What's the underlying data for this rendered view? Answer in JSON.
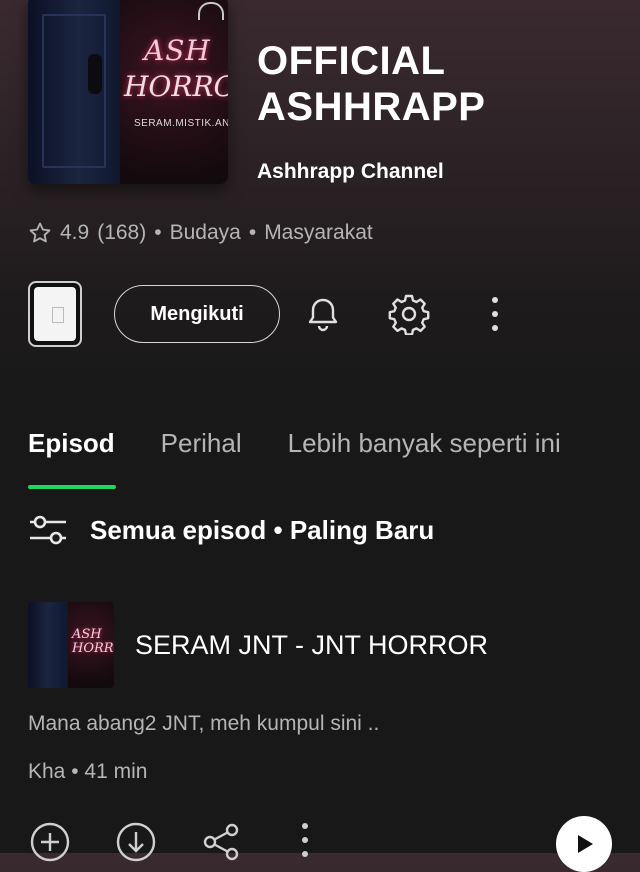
{
  "podcast": {
    "title_line1": "OFFICIAL",
    "title_line2": "ASHHRAPP",
    "channel": "Ashhrapp Channel",
    "cover": {
      "title1": "ASH",
      "title2": "HORROR",
      "subtitle": "SERAM.MISTIK.ANGKER"
    }
  },
  "rating": {
    "icon": "star-outline-icon",
    "score": "4.9",
    "count": "(168)",
    "separator": "•",
    "categories": [
      "Budaya",
      "Masyarakat"
    ]
  },
  "actions": {
    "follow_label": "Mengikuti",
    "icons": [
      "bell-icon",
      "gear-icon",
      "more-vertical-icon"
    ]
  },
  "tabs": [
    {
      "label": "Episod",
      "active": true
    },
    {
      "label": "Perihal",
      "active": false
    },
    {
      "label": "Lebih banyak seperti ini",
      "active": false
    }
  ],
  "filter": {
    "icon": "filter-sliders-icon",
    "label": "Semua episod • Paling Baru"
  },
  "episode": {
    "title": "SERAM JNT - JNT HORROR",
    "description": "Mana abang2 JNT, meh kumpul sini ..",
    "meta": "Kha • 41 min",
    "thumb_text1": "ASH",
    "thumb_text2": "HORROR",
    "action_icons": [
      "add-circle-icon",
      "download-circle-icon",
      "share-icon",
      "more-vertical-icon",
      "play-icon"
    ]
  },
  "colors": {
    "accent": "#1ed760",
    "background": "#181818",
    "muted_text": "#b5b5b5"
  }
}
